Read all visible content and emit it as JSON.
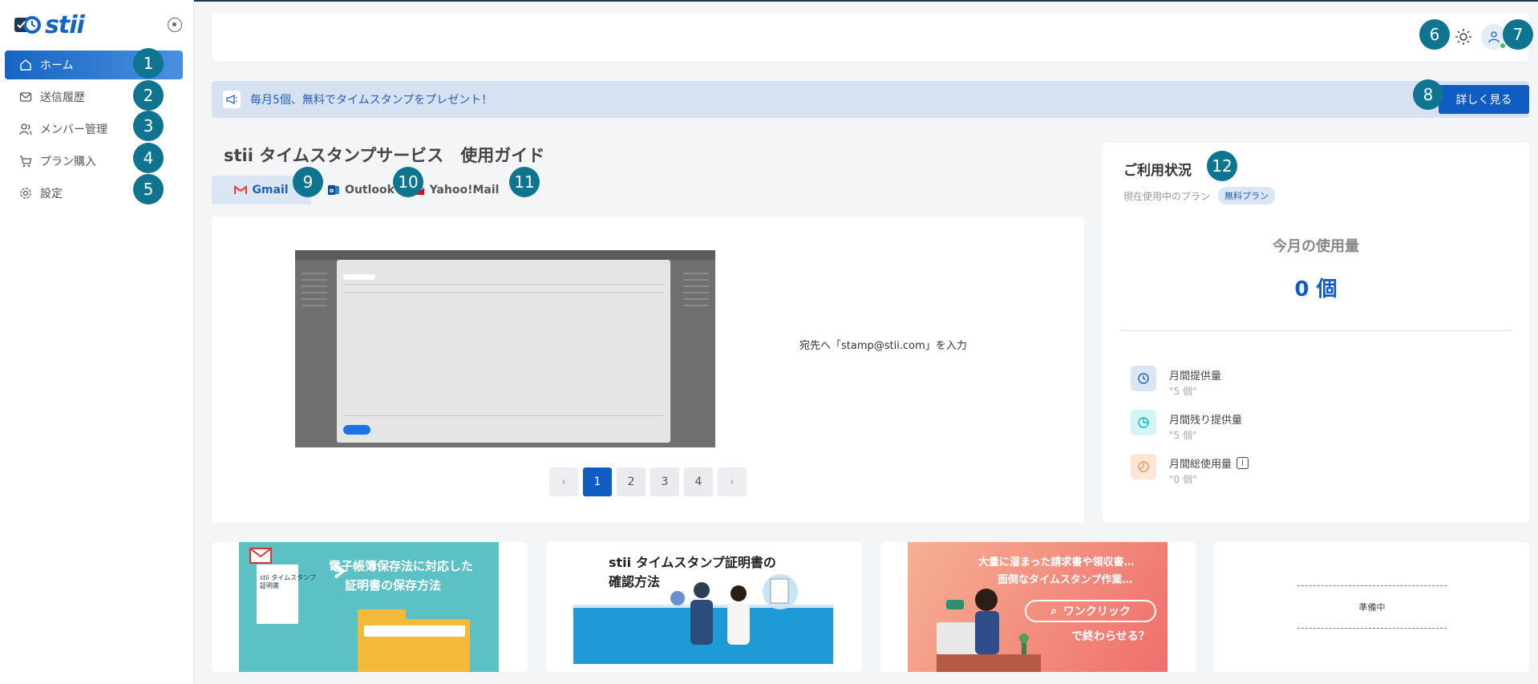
{
  "app": {
    "logo_text": "stii",
    "colors": {
      "primary": "#0f5dc2",
      "marker": "#0e7490",
      "banner_bg": "#d6e2f1"
    }
  },
  "sidebar": {
    "items": [
      {
        "label": "ホーム",
        "icon": "home-icon",
        "active": true
      },
      {
        "label": "送信履歴",
        "icon": "mail-icon",
        "active": false
      },
      {
        "label": "メンバー管理",
        "icon": "users-icon",
        "active": false
      },
      {
        "label": "プラン購入",
        "icon": "cart-icon",
        "active": false
      },
      {
        "label": "設定",
        "icon": "gear-icon",
        "active": false
      }
    ]
  },
  "header": {
    "theme_icon": "sun-icon",
    "avatar_icon": "user-icon"
  },
  "banner": {
    "icon": "megaphone-icon",
    "text": "毎月5個、無料でタイムスタンプをプレゼント！",
    "button_label": "詳しく見る"
  },
  "guide": {
    "title": "stii タイムスタンプサービス　使用ガイド",
    "tabs": [
      {
        "label": "Gmail",
        "icon": "gmail-icon",
        "active": true
      },
      {
        "label": "Outlook",
        "icon": "outlook-icon",
        "active": false
      },
      {
        "label": "Yahoo!Mail",
        "icon": "yahoo-mail-icon",
        "active": false
      }
    ],
    "caption": "宛先へ「stamp@stii.com」を入力",
    "pages": [
      "1",
      "2",
      "3",
      "4"
    ],
    "current_page": "1",
    "prev_label": "‹",
    "next_label": "›"
  },
  "usage": {
    "title": "ご利用状況",
    "plan_label": "現在使用中のプラン",
    "plan_badge": "無料プラン",
    "month_label": "今月の使用量",
    "month_value": "0 個",
    "stats": [
      {
        "label": "月間提供量",
        "value": "\"5 個\"",
        "icon": "clock-icon",
        "color": "#1565c0"
      },
      {
        "label": "月間残り提供量",
        "value": "\"5 個\"",
        "icon": "pie-icon",
        "color": "#14b8c6"
      },
      {
        "label": "月間総使用量",
        "value": "\"0 個\"",
        "icon": "pie-chart-icon",
        "color": "#f29b5c",
        "info": "i"
      }
    ]
  },
  "articles": [
    {
      "title_line1": "電子帳簿保存法に対応した",
      "title_line2": "証明書の保存方法",
      "doc_line1": "stii タイムスタンプ",
      "doc_line2": "証明書"
    },
    {
      "title_line1": "stii タイムスタンプ証明書の",
      "title_line2": "確認方法"
    },
    {
      "title_line1": "大量に溜まった請求書や領収書…",
      "title_line2": "面倒なタイムスタンプ作業…",
      "search_label": "ワンクリック",
      "title_line3": "で終わらせる？"
    },
    {
      "soon_label": "準備中"
    }
  ],
  "markers": [
    "1",
    "2",
    "3",
    "4",
    "5",
    "6",
    "7",
    "8",
    "9",
    "10",
    "11",
    "12"
  ]
}
